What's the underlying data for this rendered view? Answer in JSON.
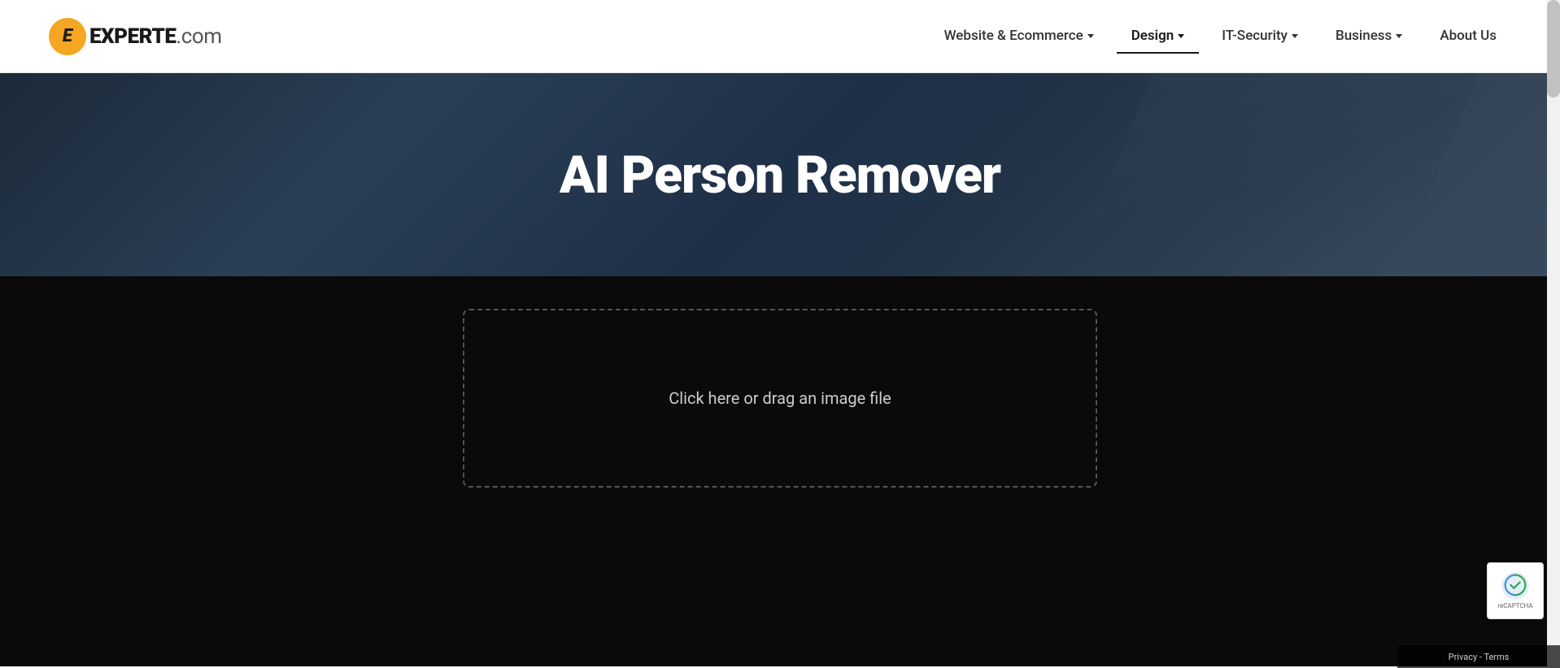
{
  "site": {
    "logo_icon_letter": "E",
    "logo_brand": "EXPERTE",
    "logo_suffix": ".com"
  },
  "navbar": {
    "links": [
      {
        "id": "website-ecommerce",
        "label": "Website & Ecommerce",
        "has_dropdown": true,
        "active": false
      },
      {
        "id": "design",
        "label": "Design",
        "has_dropdown": true,
        "active": true
      },
      {
        "id": "it-security",
        "label": "IT-Security",
        "has_dropdown": true,
        "active": false
      },
      {
        "id": "business",
        "label": "Business",
        "has_dropdown": true,
        "active": false
      },
      {
        "id": "about-us",
        "label": "About Us",
        "has_dropdown": false,
        "active": false
      }
    ]
  },
  "hero": {
    "title": "AI Person Remover"
  },
  "upload": {
    "drop_zone_text": "Click here or drag an image file"
  },
  "recaptcha": {
    "badge_title": "reCAPTCHA"
  },
  "privacy": {
    "text": "Privacy - Terms"
  }
}
